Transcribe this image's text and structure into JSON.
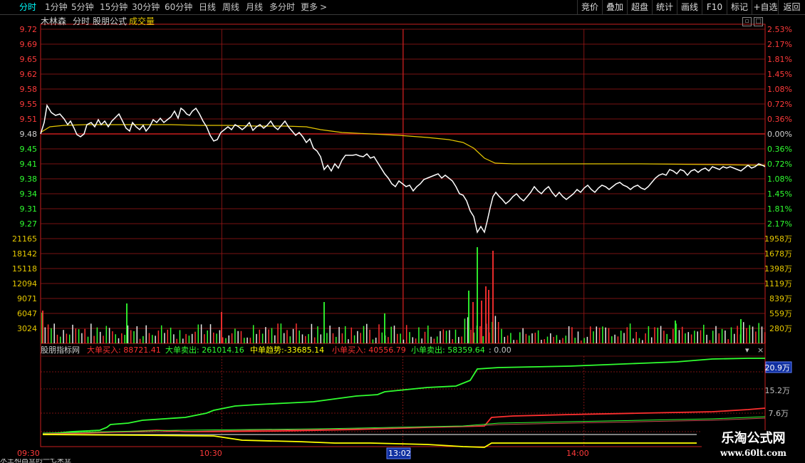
{
  "toolbar": {
    "periods": [
      "分时",
      "1分钟",
      "5分钟",
      "15分钟",
      "30分钟",
      "60分钟",
      "日线",
      "周线",
      "月线",
      "多分时",
      "更多"
    ],
    "active_period": "分时",
    "more_arrow": ">",
    "right_buttons": [
      "竞价",
      "叠加",
      "超盘",
      "统计",
      "画线",
      "F10",
      "标记",
      "+自选",
      "返回"
    ]
  },
  "title_bar": {
    "stock_name": "木林森",
    "mode": "分时",
    "formula": "股朋公式",
    "volume_label": "成交量"
  },
  "price_axis": {
    "left_labels": [
      "9.72",
      "9.69",
      "9.65",
      "9.62",
      "9.58",
      "9.55",
      "9.51",
      "9.48",
      "9.45",
      "9.41",
      "9.38",
      "9.34",
      "9.31",
      "9.27"
    ],
    "right_labels": [
      "2.53%",
      "2.17%",
      "1.81%",
      "1.45%",
      "1.08%",
      "0.72%",
      "0.36%",
      "0.00%",
      "0.36%",
      "0.72%",
      "1.08%",
      "1.45%",
      "1.81%",
      "2.17%"
    ],
    "prev_close": 9.48
  },
  "volume_axis": {
    "left_labels": [
      "21165",
      "18142",
      "15118",
      "12094",
      "9071",
      "6047",
      "3024"
    ],
    "right_labels": [
      "1958万",
      "1678万",
      "1398万",
      "1119万",
      "839万",
      "559万",
      "280万"
    ]
  },
  "indicator": {
    "name": "股朋指标网",
    "items": [
      {
        "label": "大单买入",
        "value": "88721.41",
        "color": "#ff3030"
      },
      {
        "label": "大单卖出",
        "value": "261014.16",
        "color": "#30ff30"
      },
      {
        "label": "中单趋势",
        "value": "-33685.14",
        "color": "#ffff00"
      },
      {
        "label": "小单买入",
        "value": "40556.79",
        "color": "#ff3030"
      },
      {
        "label": "小单卖出",
        "value": "58359.64",
        "color": "#30ff30"
      }
    ],
    "extra": ": 0.00",
    "axis_labels": [
      "20.9万",
      "15.2万",
      "7.6万"
    ]
  },
  "time_axis": {
    "labels": [
      "09:30",
      "10:30",
      "13:02",
      "14:00"
    ]
  },
  "watermark": {
    "name": "乐淘公式网",
    "url": "www.60lt.com"
  },
  "bottom_strip": "水生和昌业的一七来业"
}
